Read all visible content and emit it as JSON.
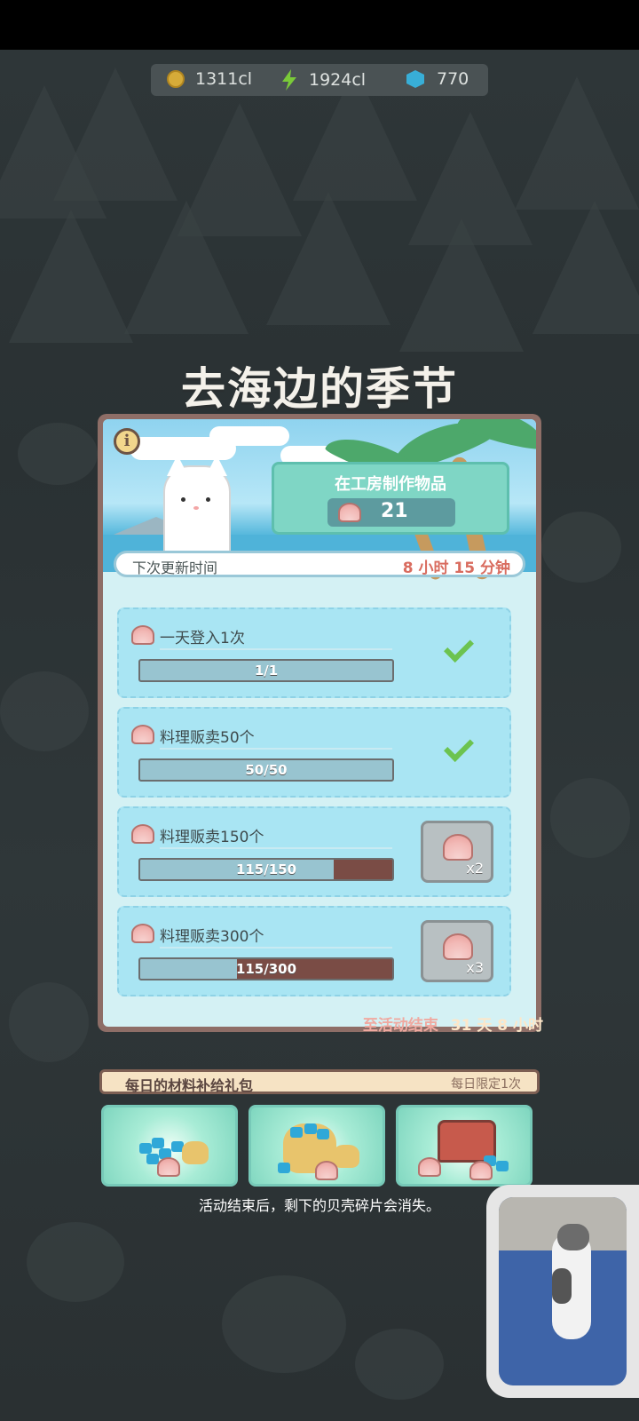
{
  "resources": {
    "coins": "1311cl",
    "energy": "1924cl",
    "gems": "770"
  },
  "event": {
    "title": "去海边的季节",
    "craft_label": "在工房制作物品",
    "craft_count": "21",
    "next_update_label": "下次更新时间",
    "next_update_value": "8 小时 15 分钟"
  },
  "tasks": [
    {
      "label": "一天登入1次",
      "progress_text": "1/1",
      "progress": 1.0,
      "status": "completed"
    },
    {
      "label": "料理贩卖50个",
      "progress_text": "50/50",
      "progress": 1.0,
      "status": "completed"
    },
    {
      "label": "料理贩卖150个",
      "progress_text": "115/150",
      "progress": 0.767,
      "status": "reward",
      "reward": "x2"
    },
    {
      "label": "料理贩卖300个",
      "progress_text": "115/300",
      "progress": 0.383,
      "status": "reward",
      "reward": "x3"
    }
  ],
  "event_end": {
    "label": "至活动结束",
    "value": "31 天 8 小时"
  },
  "package": {
    "title": "每日的材料补给礼包",
    "limit": "每日限定1次"
  },
  "footer_note": "活动结束后，剩下的贝壳碎片会消失。",
  "colors": {
    "accent_teal": "#7fd6c5",
    "progress_fill": "#98c4d0",
    "progress_empty": "#7a4c45",
    "end_label": "#f0a9a0",
    "end_value": "#fde7c9"
  }
}
